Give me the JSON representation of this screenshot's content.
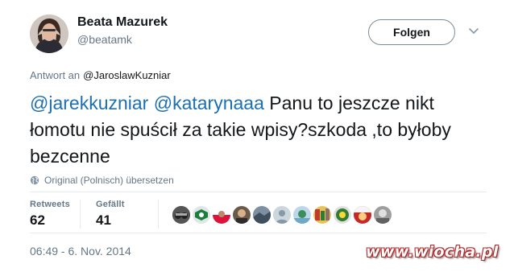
{
  "user": {
    "name": "Beata Mazurek",
    "handle": "@beatamk"
  },
  "follow_button": {
    "label": "Folgen"
  },
  "reply": {
    "prefix": "Antwort an",
    "to": "@JaroslawKuzniar"
  },
  "tweet": {
    "mention1": "@jarekkuzniar",
    "mention2": "@katarynaaa",
    "body": " Panu to jeszcze nikt łomotu nie spuścił za takie wpisy?szkoda ,to byłoby bezcenne"
  },
  "translate": {
    "label": "Original (Polnisch) übersetzen"
  },
  "stats": {
    "retweets_label": "Retweets",
    "retweets_count": "62",
    "likes_label": "Gefällt",
    "likes_count": "41"
  },
  "likers": [
    "avatar-1",
    "avatar-2",
    "avatar-3",
    "avatar-4",
    "avatar-5",
    "avatar-6",
    "avatar-7",
    "avatar-8",
    "avatar-9",
    "avatar-10",
    "avatar-11"
  ],
  "timestamp": "06:49 - 6. Nov. 2014",
  "watermark": "www.wiocha.pl",
  "colors": {
    "link": "#1b6fb3",
    "muted": "#657786",
    "text": "#14171a",
    "watermark_outline": "#b22222"
  }
}
